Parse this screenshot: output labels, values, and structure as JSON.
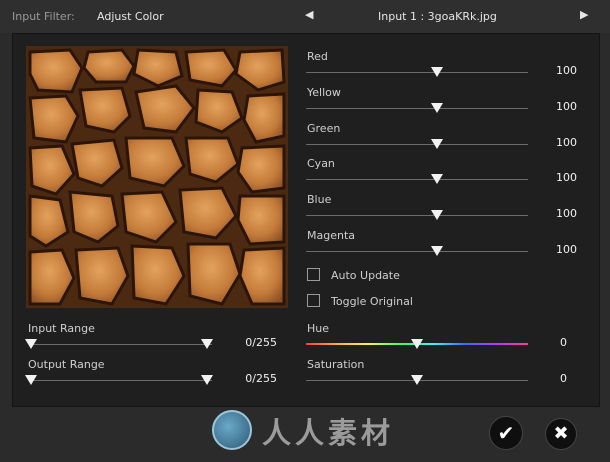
{
  "header": {
    "filter_label": "Input Filter:",
    "filter_value": "Adjust Color",
    "prev_icon": "triangle-left",
    "next_icon": "triangle-right",
    "input_name": "Input 1 : 3goaKRk.jpg"
  },
  "color_sliders": [
    {
      "label": "Red",
      "value": "100",
      "level": 0.58
    },
    {
      "label": "Yellow",
      "value": "100",
      "level": 0.58
    },
    {
      "label": "Green",
      "value": "100",
      "level": 0.58
    },
    {
      "label": "Cyan",
      "value": "100",
      "level": 0.58
    },
    {
      "label": "Blue",
      "value": "100",
      "level": 0.58
    },
    {
      "label": "Magenta",
      "value": "100",
      "level": 0.58
    }
  ],
  "checkboxes": [
    {
      "label": "Auto Update",
      "checked": false
    },
    {
      "label": "Toggle Original",
      "checked": false
    }
  ],
  "hue": {
    "label": "Hue",
    "value": "0",
    "level": 0.5
  },
  "saturation": {
    "label": "Saturation",
    "value": "0",
    "level": 0.5
  },
  "input_range": {
    "label": "Input Range",
    "value": "0/255",
    "low": 0,
    "high": 255
  },
  "output_range": {
    "label": "Output Range",
    "value": "0/255",
    "low": 0,
    "high": 255
  },
  "footer": {
    "watermark_text": "人人素材",
    "ok_icon": "checkmark",
    "cancel_icon": "x"
  },
  "colors": {
    "background": "#2b2b2b",
    "panel": "#1f1f1f",
    "text": "#d6d6d6",
    "thumb": "#f2f2f2"
  }
}
